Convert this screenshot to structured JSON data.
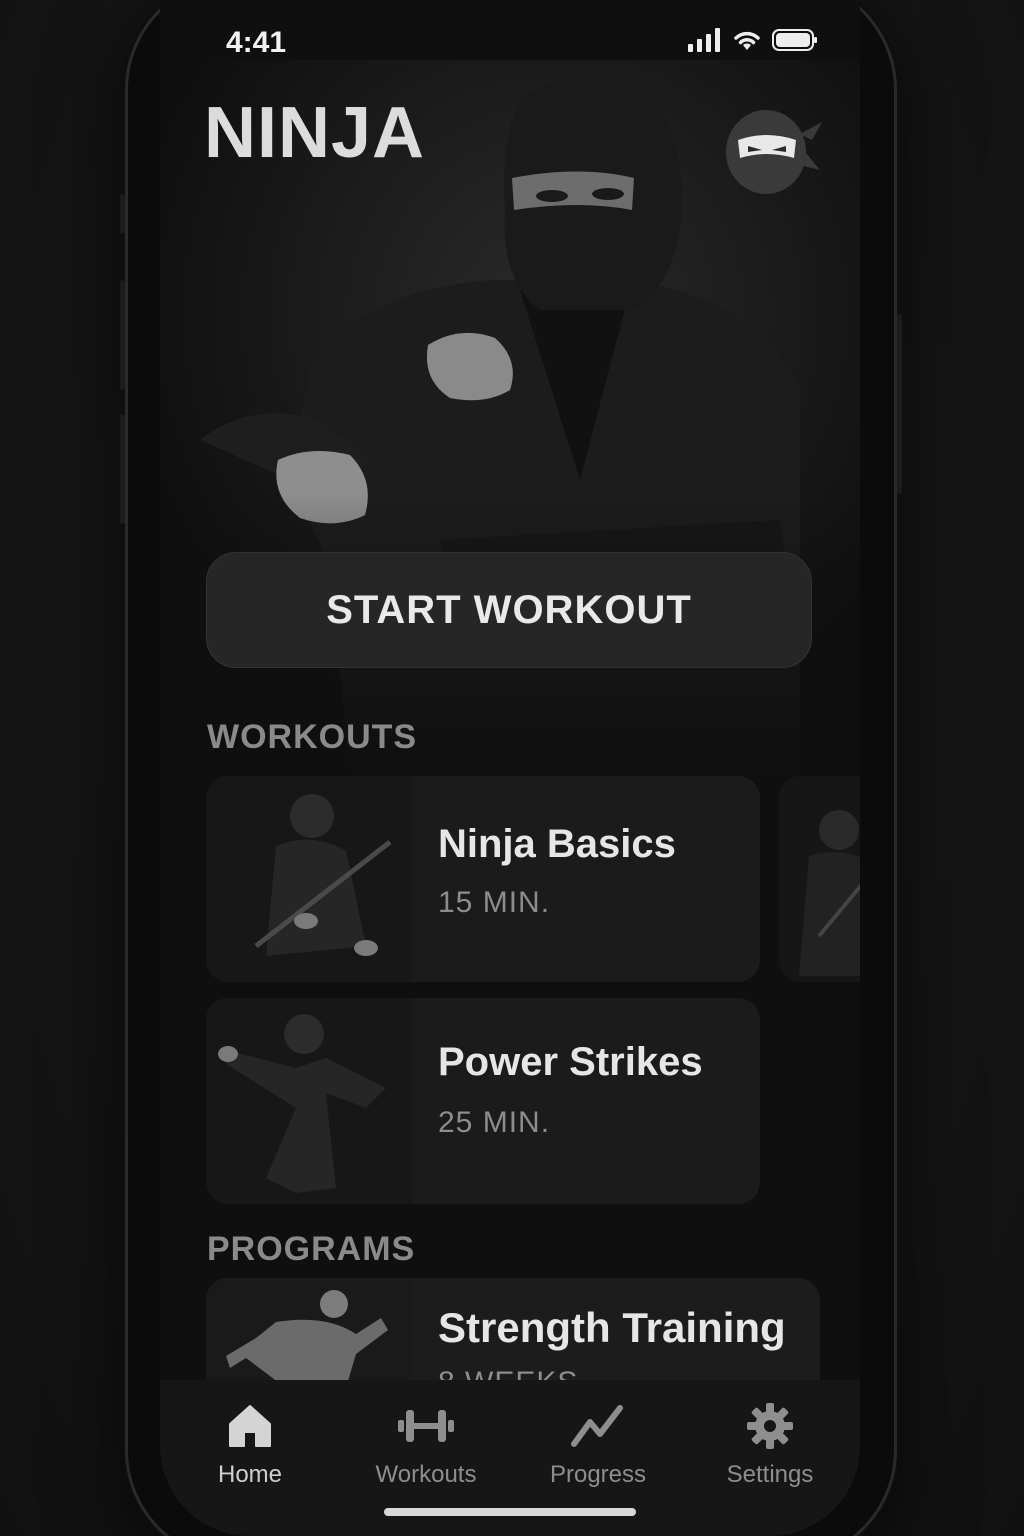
{
  "status_bar": {
    "time": "4:41"
  },
  "app": {
    "title": "NINJA"
  },
  "hero": {
    "cta_label": "START WORKOUT"
  },
  "sections": {
    "workouts": "WORKOUTS",
    "programs": "PROGRAMS"
  },
  "workouts": [
    {
      "title": "Ninja Basics",
      "duration": "15 MIN."
    },
    {
      "title": "Power Strikes",
      "duration": "25 MIN."
    }
  ],
  "programs": [
    {
      "title": "Strength Training",
      "duration": "8 WEEKS"
    }
  ],
  "tabs": [
    {
      "label": "Home",
      "icon": "home-icon",
      "active": true
    },
    {
      "label": "Workouts",
      "icon": "dumbbell-icon",
      "active": false
    },
    {
      "label": "Progress",
      "icon": "trend-line-icon",
      "active": false
    },
    {
      "label": "Settings",
      "icon": "gear-icon",
      "active": false
    }
  ],
  "colors": {
    "background": "#0f0f0f",
    "card": "#1b1b1b",
    "accent_text": "#e6e6e6",
    "muted_text": "#8a8a8a"
  }
}
